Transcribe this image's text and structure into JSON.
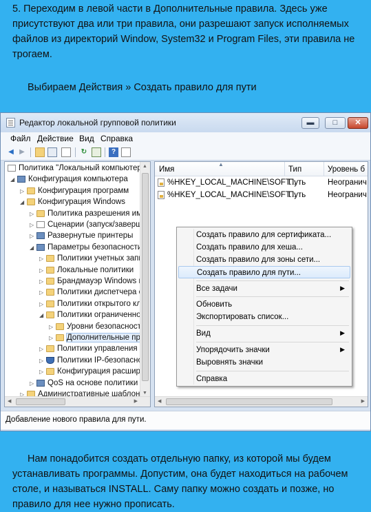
{
  "step_text": "5.   Переходим в левой части в Дополнительные правила. Здесь уже присутствуют два или три правила, они разрешают запуск исполняемых файлов из директорий Window, System32 и Program Files, эти правила не трогаем.",
  "action_text": "Выбираем Действия » Создать правило для пути",
  "bottom_text": "Нам понадобится создать отдельную папку, из которой мы будем устанавливать программы. Допустим, она будет находиться на рабочем столе, и называться INSTALL. Саму папку можно создать и позже, но правило для нее нужно прописать.",
  "window": {
    "title": "Редактор локальной групповой политики",
    "menu": [
      "Файл",
      "Действие",
      "Вид",
      "Справка"
    ],
    "status": "Добавление нового правила для пути."
  },
  "tree": [
    {
      "label": "Политика \"Локальный компьютер",
      "icon": "policy-icon",
      "level": 0
    },
    {
      "label": "Конфигурация компьютера",
      "icon": "computer-icon",
      "level": 1,
      "expanded": true
    },
    {
      "label": "Конфигурация программ",
      "icon": "folder-icon",
      "level": 2
    },
    {
      "label": "Конфигурация Windows",
      "icon": "folder-icon",
      "level": 2,
      "expanded": true
    },
    {
      "label": "Политика разрешения им",
      "icon": "folder-icon",
      "level": 3
    },
    {
      "label": "Сценарии (запуск/заверш",
      "icon": "script-icon",
      "level": 3
    },
    {
      "label": "Развернутые принтеры",
      "icon": "printer-icon",
      "level": 3
    },
    {
      "label": "Параметры безопасности",
      "icon": "security-icon",
      "level": 3,
      "expanded": true
    },
    {
      "label": "Политики учетных запи",
      "icon": "folder-icon",
      "level": 4
    },
    {
      "label": "Локальные политики",
      "icon": "folder-icon",
      "level": 4
    },
    {
      "label": "Брандмауэр Windows в",
      "icon": "folder-icon",
      "level": 4
    },
    {
      "label": "Политики диспетчера с",
      "icon": "folder-icon",
      "level": 4
    },
    {
      "label": "Политики открытого кл",
      "icon": "folder-icon",
      "level": 4
    },
    {
      "label": "Политики ограниченно",
      "icon": "folder-icon",
      "level": 4,
      "expanded": true
    },
    {
      "label": "Уровни безопасност",
      "icon": "folder-icon",
      "level": 5
    },
    {
      "label": "Дополнительные пр",
      "icon": "folder-icon",
      "level": 5,
      "selected": true
    },
    {
      "label": "Политики управления",
      "icon": "folder-icon",
      "level": 4
    },
    {
      "label": "Политики IP-безопасно",
      "icon": "shield-icon",
      "level": 4
    },
    {
      "label": "Конфигурация расшир",
      "icon": "folder-icon",
      "level": 4
    },
    {
      "label": "QoS на основе политики",
      "icon": "chart-icon",
      "level": 3
    },
    {
      "label": "Административные шаблоны",
      "icon": "folder-icon",
      "level": 2
    }
  ],
  "list": {
    "columns": [
      "Имя",
      "Тип",
      "Уровень б"
    ],
    "rows": [
      {
        "name": "%HKEY_LOCAL_MACHINE\\SOFT...",
        "type": "Путь",
        "level": "Неогранич"
      },
      {
        "name": "%HKEY_LOCAL_MACHINE\\SOFT...",
        "type": "Путь",
        "level": "Неогранич"
      }
    ]
  },
  "context_menu": [
    {
      "label": "Создать правило для сертификата..."
    },
    {
      "label": "Создать правило для хеша..."
    },
    {
      "label": "Создать правило для зоны сети..."
    },
    {
      "label": "Создать правило для пути...",
      "highlighted": true
    },
    {
      "label": "Все задачи",
      "submenu": true
    },
    {
      "label": "Обновить"
    },
    {
      "label": "Экспортировать список..."
    },
    {
      "label": "Вид",
      "submenu": true
    },
    {
      "label": "Упорядочить значки",
      "submenu": true
    },
    {
      "label": "Выровнять значки"
    },
    {
      "label": "Справка"
    }
  ],
  "colors": {
    "background": "#33b1f0",
    "menu_highlight": "#dcebfc"
  }
}
